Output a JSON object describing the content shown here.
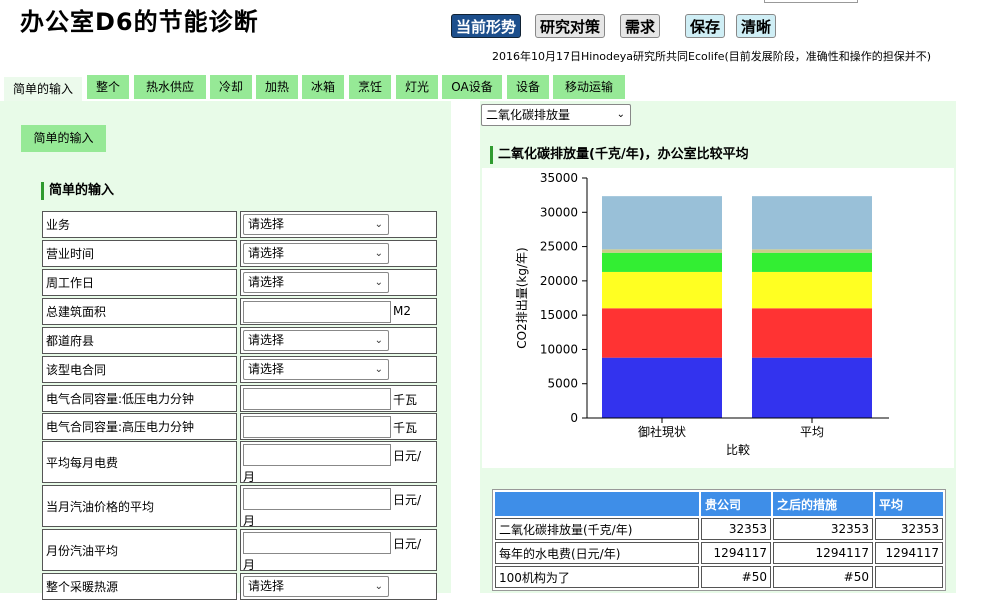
{
  "page_title": "办公室D6的节能诊断",
  "top_buttons": {
    "current": "当前形势",
    "research": "研究对策",
    "demand": "需求",
    "save": "保存",
    "clear": "清晰"
  },
  "credit": "2016年10月17日Hinodeya研究所共同Ecolife(目前发展阶段，准确性和操作的担保并不)",
  "tabs": [
    "简单的输入",
    "整个",
    "热水供应",
    "冷却",
    "加热",
    "冰箱",
    "烹饪",
    "灯光",
    "OA设备",
    "设备",
    "移动运输"
  ],
  "left": {
    "section_button": "简单的输入",
    "section_title": "简单的输入",
    "rows": [
      {
        "label": "业务",
        "type": "select",
        "value": "请选择"
      },
      {
        "label": "营业时间",
        "type": "select",
        "value": "请选择"
      },
      {
        "label": "周工作日",
        "type": "select",
        "value": "请选择"
      },
      {
        "label": "总建筑面积",
        "type": "input",
        "unit": "M2"
      },
      {
        "label": "都道府县",
        "type": "select",
        "value": "请选择"
      },
      {
        "label": "该型电合同",
        "type": "select",
        "value": "请选择"
      },
      {
        "label": "电气合同容量:低压电力分钟",
        "type": "input",
        "unit": "千瓦"
      },
      {
        "label": "电气合同容量:高压电力分钟",
        "type": "input",
        "unit": "千瓦"
      },
      {
        "label": "平均每月电费",
        "type": "input2",
        "unit": "日元/",
        "unit2": "月"
      },
      {
        "label": "当月汽油价格的平均",
        "type": "input2",
        "unit": "日元/",
        "unit2": "月"
      },
      {
        "label": "月份汽油平均",
        "type": "input2",
        "unit": "日元/",
        "unit2": "月"
      },
      {
        "label": "整个采暖热源",
        "type": "select",
        "value": "请选择"
      }
    ]
  },
  "right": {
    "metric_select": "二氧化碳排放量",
    "chart_title": "二氧化碳排放量(千克/年)，办公室比较平均"
  },
  "chart_data": {
    "type": "bar",
    "stacked": true,
    "categories": [
      "御社現状",
      "平均"
    ],
    "xlabel": "比較",
    "ylabel": "CO2排出量(kg/年)",
    "ylim": [
      0,
      35000
    ],
    "yticks": [
      0,
      5000,
      10000,
      15000,
      20000,
      25000,
      30000,
      35000
    ],
    "series": [
      {
        "color": "#3333ee",
        "values": [
          8800,
          8800
        ]
      },
      {
        "color": "#ff3333",
        "values": [
          7200,
          7200
        ]
      },
      {
        "color": "#ffff22",
        "values": [
          5300,
          5300
        ]
      },
      {
        "color": "#33ee33",
        "values": [
          2800,
          2800
        ]
      },
      {
        "color": "#cccc88",
        "values": [
          500,
          500
        ]
      },
      {
        "color": "#99c0d8",
        "values": [
          7753,
          7753
        ]
      }
    ]
  },
  "table": {
    "headers": [
      "",
      "贵公司",
      "之后的措施",
      "平均"
    ],
    "rows": [
      [
        "二氧化碳排放量(千克/年)",
        "32353",
        "32353",
        "32353"
      ],
      [
        "每年的水电费(日元/年)",
        "1294117",
        "1294117",
        "1294117"
      ],
      [
        "100机构为了",
        "#50",
        "#50",
        ""
      ]
    ]
  },
  "colors": {
    "tab_green": "#96e996",
    "panel_green": "#e8fbe8",
    "header_blue": "#3e8ee8",
    "button_navy": "#1d4f8c"
  }
}
